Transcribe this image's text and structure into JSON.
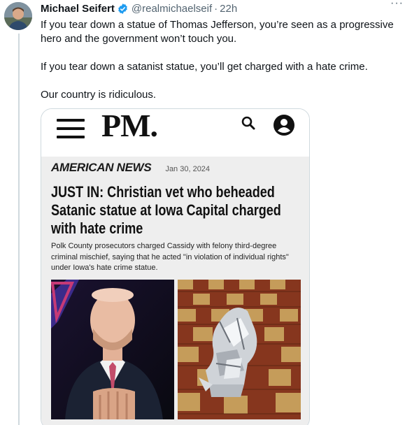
{
  "tweet": {
    "author_name": "Michael Seifert",
    "handle": "@realmichaelseif",
    "separator": "·",
    "time": "22h",
    "more_label": "···",
    "paragraphs": [
      "If you tear down a statue of Thomas Jefferson, you’re seen as a progressive hero and the government won’t touch you.",
      "If you tear down a satanist statue, you’ll get charged with a hate crime.",
      "Our country is ridiculous."
    ]
  },
  "card": {
    "logo": "PM.",
    "section": "AMERICAN NEWS",
    "date": "Jan 30, 2024",
    "headline": "JUST IN: Christian vet who beheaded Satanic statue at Iowa Capital charged with hate crime",
    "summary": "Polk County prosecutors charged Cassidy with felony third-degree criminal mischief, saying that he acted \"in violation of individual rights\" under Iowa's hate crime statue."
  },
  "icons": {
    "verified": "verified-badge-icon",
    "menu": "hamburger-menu-icon",
    "search": "search-icon",
    "account": "account-icon"
  },
  "colors": {
    "verified_blue": "#1d9bf0",
    "secondary_text": "#536471",
    "card_background": "#eeeeee"
  }
}
